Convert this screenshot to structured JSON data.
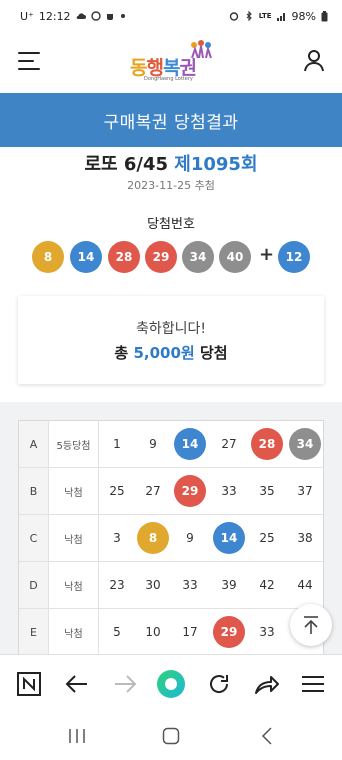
{
  "status_bar": {
    "carrier": "U⁺",
    "time": "12:12",
    "network": "LTE",
    "battery": "98%"
  },
  "header": {
    "logo_text": [
      "동",
      "행",
      "복",
      "권"
    ],
    "logo_sub": "DongHaeng Lottery",
    "menu_icon": "hamburger-icon",
    "user_icon": "user-icon"
  },
  "banner": {
    "title": "구매복권 당첨결과"
  },
  "draw": {
    "game": "로또 6/45",
    "round": "제1095회",
    "date": "2023-11-25 추첨",
    "winning_label": "당첨번호",
    "plus_sign": "+",
    "numbers": [
      {
        "n": "8",
        "color": "#e0a82e"
      },
      {
        "n": "14",
        "color": "#3e86d0"
      },
      {
        "n": "28",
        "color": "#e0574b"
      },
      {
        "n": "29",
        "color": "#e0574b"
      },
      {
        "n": "34",
        "color": "#8e8e8e"
      },
      {
        "n": "40",
        "color": "#8e8e8e"
      }
    ],
    "bonus": {
      "n": "12",
      "color": "#3e86d0"
    }
  },
  "result_card": {
    "message": "축하합니다!",
    "prefix": "총",
    "amount": "5,000원",
    "suffix": "당첨"
  },
  "tickets": [
    {
      "letter": "A",
      "result": "5등당첨",
      "numbers": [
        {
          "n": "1",
          "hit": false
        },
        {
          "n": "9",
          "hit": false
        },
        {
          "n": "14",
          "hit": true,
          "color": "#3e86d0"
        },
        {
          "n": "27",
          "hit": false
        },
        {
          "n": "28",
          "hit": true,
          "color": "#e0574b"
        },
        {
          "n": "34",
          "hit": true,
          "color": "#8e8e8e"
        }
      ]
    },
    {
      "letter": "B",
      "result": "낙첨",
      "numbers": [
        {
          "n": "25",
          "hit": false
        },
        {
          "n": "27",
          "hit": false
        },
        {
          "n": "29",
          "hit": true,
          "color": "#e0574b"
        },
        {
          "n": "33",
          "hit": false
        },
        {
          "n": "35",
          "hit": false
        },
        {
          "n": "37",
          "hit": false
        }
      ]
    },
    {
      "letter": "C",
      "result": "낙첨",
      "numbers": [
        {
          "n": "3",
          "hit": false
        },
        {
          "n": "8",
          "hit": true,
          "color": "#e0a82e"
        },
        {
          "n": "9",
          "hit": false
        },
        {
          "n": "14",
          "hit": true,
          "color": "#3e86d0"
        },
        {
          "n": "25",
          "hit": false
        },
        {
          "n": "38",
          "hit": false
        }
      ]
    },
    {
      "letter": "D",
      "result": "낙첨",
      "numbers": [
        {
          "n": "23",
          "hit": false
        },
        {
          "n": "30",
          "hit": false
        },
        {
          "n": "33",
          "hit": false
        },
        {
          "n": "39",
          "hit": false
        },
        {
          "n": "42",
          "hit": false
        },
        {
          "n": "44",
          "hit": false
        }
      ]
    },
    {
      "letter": "E",
      "result": "낙첨",
      "numbers": [
        {
          "n": "5",
          "hit": false
        },
        {
          "n": "10",
          "hit": false
        },
        {
          "n": "17",
          "hit": false
        },
        {
          "n": "29",
          "hit": true,
          "color": "#e0574b"
        },
        {
          "n": "33",
          "hit": false
        },
        {
          "n": "",
          "hit": false
        }
      ]
    }
  ],
  "browser_toolbar": {
    "icons": [
      "naver-icon",
      "back-arrow-icon",
      "forward-arrow-icon",
      "home-circle-icon",
      "refresh-icon",
      "share-icon",
      "menu-icon"
    ]
  },
  "nav_bar": {
    "icons": [
      "recent-apps-icon",
      "home-icon",
      "back-icon"
    ]
  }
}
